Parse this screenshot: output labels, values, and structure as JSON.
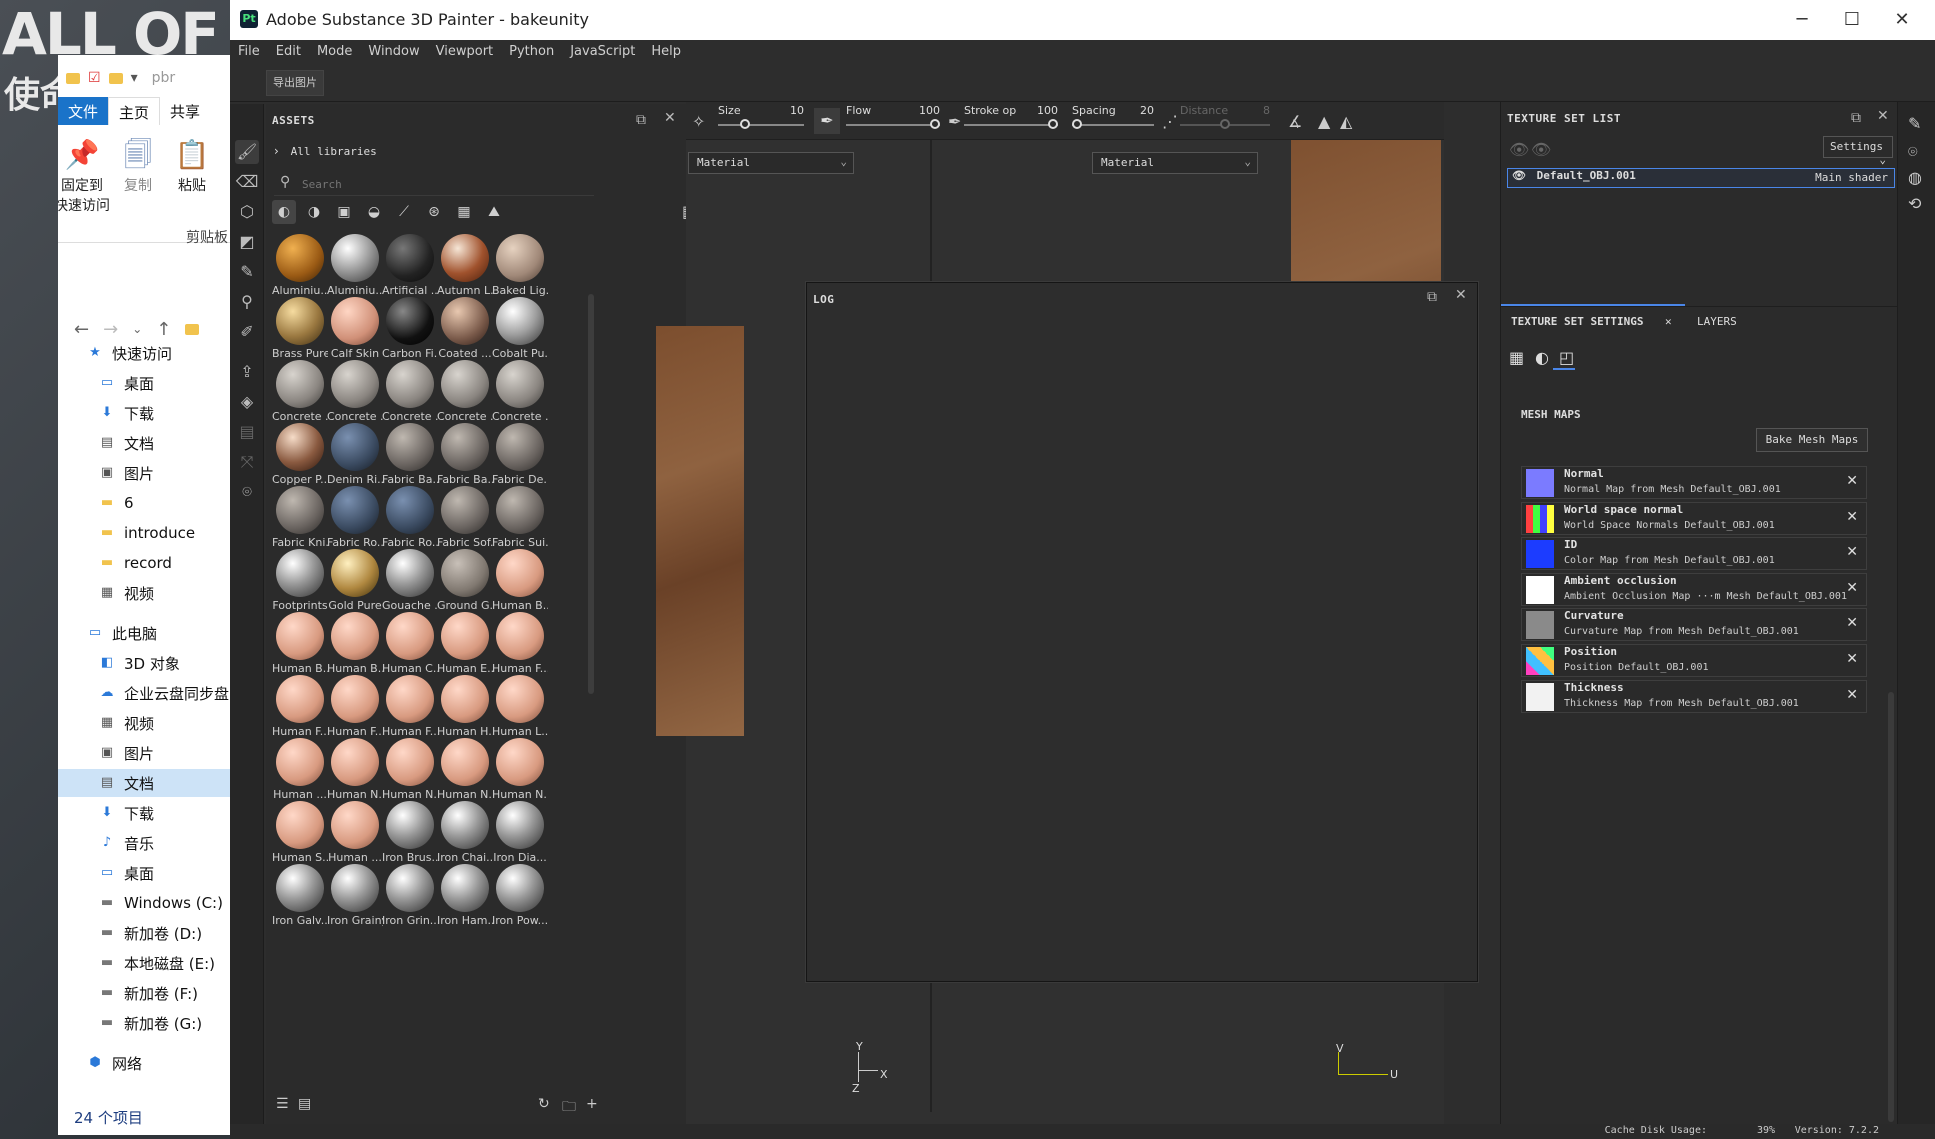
{
  "desktop": {
    "bg_text": "ALL OF DU",
    "bg_text2": "使命"
  },
  "explorer": {
    "quick_access_text": "pbr",
    "ribbon_tabs": [
      "文件",
      "主页",
      "共享"
    ],
    "ribbon_items": [
      "固定到\n快速访问",
      "复制",
      "粘贴"
    ],
    "group_label": "剪贴板",
    "tree": [
      {
        "icon": "star-icon",
        "label": "快速访问"
      },
      {
        "icon": "desktop-icon",
        "label": "桌面"
      },
      {
        "icon": "download-icon",
        "label": "下载"
      },
      {
        "icon": "document-icon",
        "label": "文档"
      },
      {
        "icon": "picture-icon",
        "label": "图片"
      },
      {
        "icon": "folder-icon",
        "label": "6"
      },
      {
        "icon": "folder-icon",
        "label": "introduce"
      },
      {
        "icon": "folder-icon",
        "label": "record"
      },
      {
        "icon": "video-icon",
        "label": "视频"
      },
      {
        "icon": "pc-icon",
        "label": "此电脑"
      },
      {
        "icon": "3d-objects-icon",
        "label": "3D 对象"
      },
      {
        "icon": "cloud-icon",
        "label": "企业云盘同步盘"
      },
      {
        "icon": "video-icon",
        "label": "视频"
      },
      {
        "icon": "picture-icon",
        "label": "图片"
      },
      {
        "icon": "document-icon",
        "label": "文档"
      },
      {
        "icon": "download-icon",
        "label": "下载"
      },
      {
        "icon": "music-icon",
        "label": "音乐"
      },
      {
        "icon": "desktop-icon",
        "label": "桌面"
      },
      {
        "icon": "drive-icon",
        "label": "Windows (C:)"
      },
      {
        "icon": "drive-icon",
        "label": "新加卷 (D:)"
      },
      {
        "icon": "drive-icon",
        "label": "本地磁盘 (E:)"
      },
      {
        "icon": "drive-icon",
        "label": "新加卷 (F:)"
      },
      {
        "icon": "drive-icon",
        "label": "新加卷 (G:)"
      },
      {
        "icon": "network-icon",
        "label": "网络"
      }
    ],
    "status": "24 个项目"
  },
  "painter": {
    "title": "Adobe Substance 3D Painter - bakeunity",
    "menu": [
      "File",
      "Edit",
      "Mode",
      "Window",
      "Viewport",
      "Python",
      "JavaScript",
      "Help"
    ],
    "export_button": "导出图片",
    "tool_props": {
      "size": {
        "label": "Size",
        "value": "10"
      },
      "flow": {
        "label": "Flow",
        "value": "100"
      },
      "stroke": {
        "label": "Stroke op",
        "value": "100"
      },
      "spacing": {
        "label": "Spacing",
        "value": "20"
      },
      "distance": {
        "label": "Distance",
        "value": "8"
      }
    },
    "material_select_left": "Material",
    "material_select_right": "Material",
    "axis_left": {
      "y": "Y",
      "z": "Z",
      "x": "X"
    },
    "axis_right": {
      "v": "V",
      "u": "U"
    },
    "log_title": "LOG"
  },
  "assets": {
    "title": "ASSETS",
    "library": "All libraries",
    "search_placeholder": "Search",
    "items": [
      "Aluminiu...",
      "Aluminiu...",
      "Artificial ...",
      "Autumn L...",
      "Baked Lig...",
      "Brass Pure",
      "Calf Skin",
      "Carbon Fi...",
      "Coated ...",
      "Cobalt Pu...",
      "Concrete ...",
      "Concrete ...",
      "Concrete ...",
      "Concrete ...",
      "Concrete ...",
      "Copper P...",
      "Denim Ri...",
      "Fabric Ba...",
      "Fabric Ba...",
      "Fabric De...",
      "Fabric Kni...",
      "Fabric Ro...",
      "Fabric Ro...",
      "Fabric Sof...",
      "Fabric Sui...",
      "Footprints",
      "Gold Pure",
      "Gouache ...",
      "Ground G...",
      "Human B...",
      "Human B...",
      "Human B...",
      "Human C...",
      "Human E...",
      "Human F...",
      "Human F...",
      "Human F...",
      "Human F...",
      "Human H...",
      "Human L...",
      "Human ...",
      "Human N...",
      "Human N...",
      "Human N...",
      "Human N...",
      "Human S...",
      "Human ...",
      "Iron Brus...",
      "Iron Chai...",
      "Iron Dia...",
      "Iron Galv...",
      "Iron Grainy",
      "Iron Grin...",
      "Iron Ham...",
      "Iron Pow..."
    ]
  },
  "texture_set_list": {
    "title": "TEXTURE SET LIST",
    "settings": "Settings",
    "row_name": "Default_OBJ.001",
    "row_shader": "Main shader"
  },
  "texture_set_settings": {
    "tab1": "TEXTURE SET SETTINGS",
    "tab2": "LAYERS",
    "mesh_maps_title": "MESH MAPS",
    "bake_button": "Bake Mesh Maps",
    "maps": [
      {
        "name": "Normal",
        "desc": "Normal Map from Mesh Default_OBJ.001",
        "color": "#7b7bff"
      },
      {
        "name": "World space normal",
        "desc": "World Space Normals Default_OBJ.001",
        "color": "multi"
      },
      {
        "name": "ID",
        "desc": "Color Map from Mesh Default_OBJ.001",
        "color": "#1c3cff"
      },
      {
        "name": "Ambient occlusion",
        "desc": "Ambient Occlusion Map ···m Mesh Default_OBJ.001",
        "color": "#ffffff"
      },
      {
        "name": "Curvature",
        "desc": "Curvature Map from Mesh Default_OBJ.001",
        "color": "#8a8a8a"
      },
      {
        "name": "Position",
        "desc": "Position Default_OBJ.001",
        "color": "multi2"
      },
      {
        "name": "Thickness",
        "desc": "Thickness Map from Mesh Default_OBJ.001",
        "color": "#f2f2f2"
      }
    ]
  },
  "status": {
    "cache_label": "Cache Disk Usage:",
    "cache_value": "39%",
    "version": "Version: 7.2.2"
  }
}
